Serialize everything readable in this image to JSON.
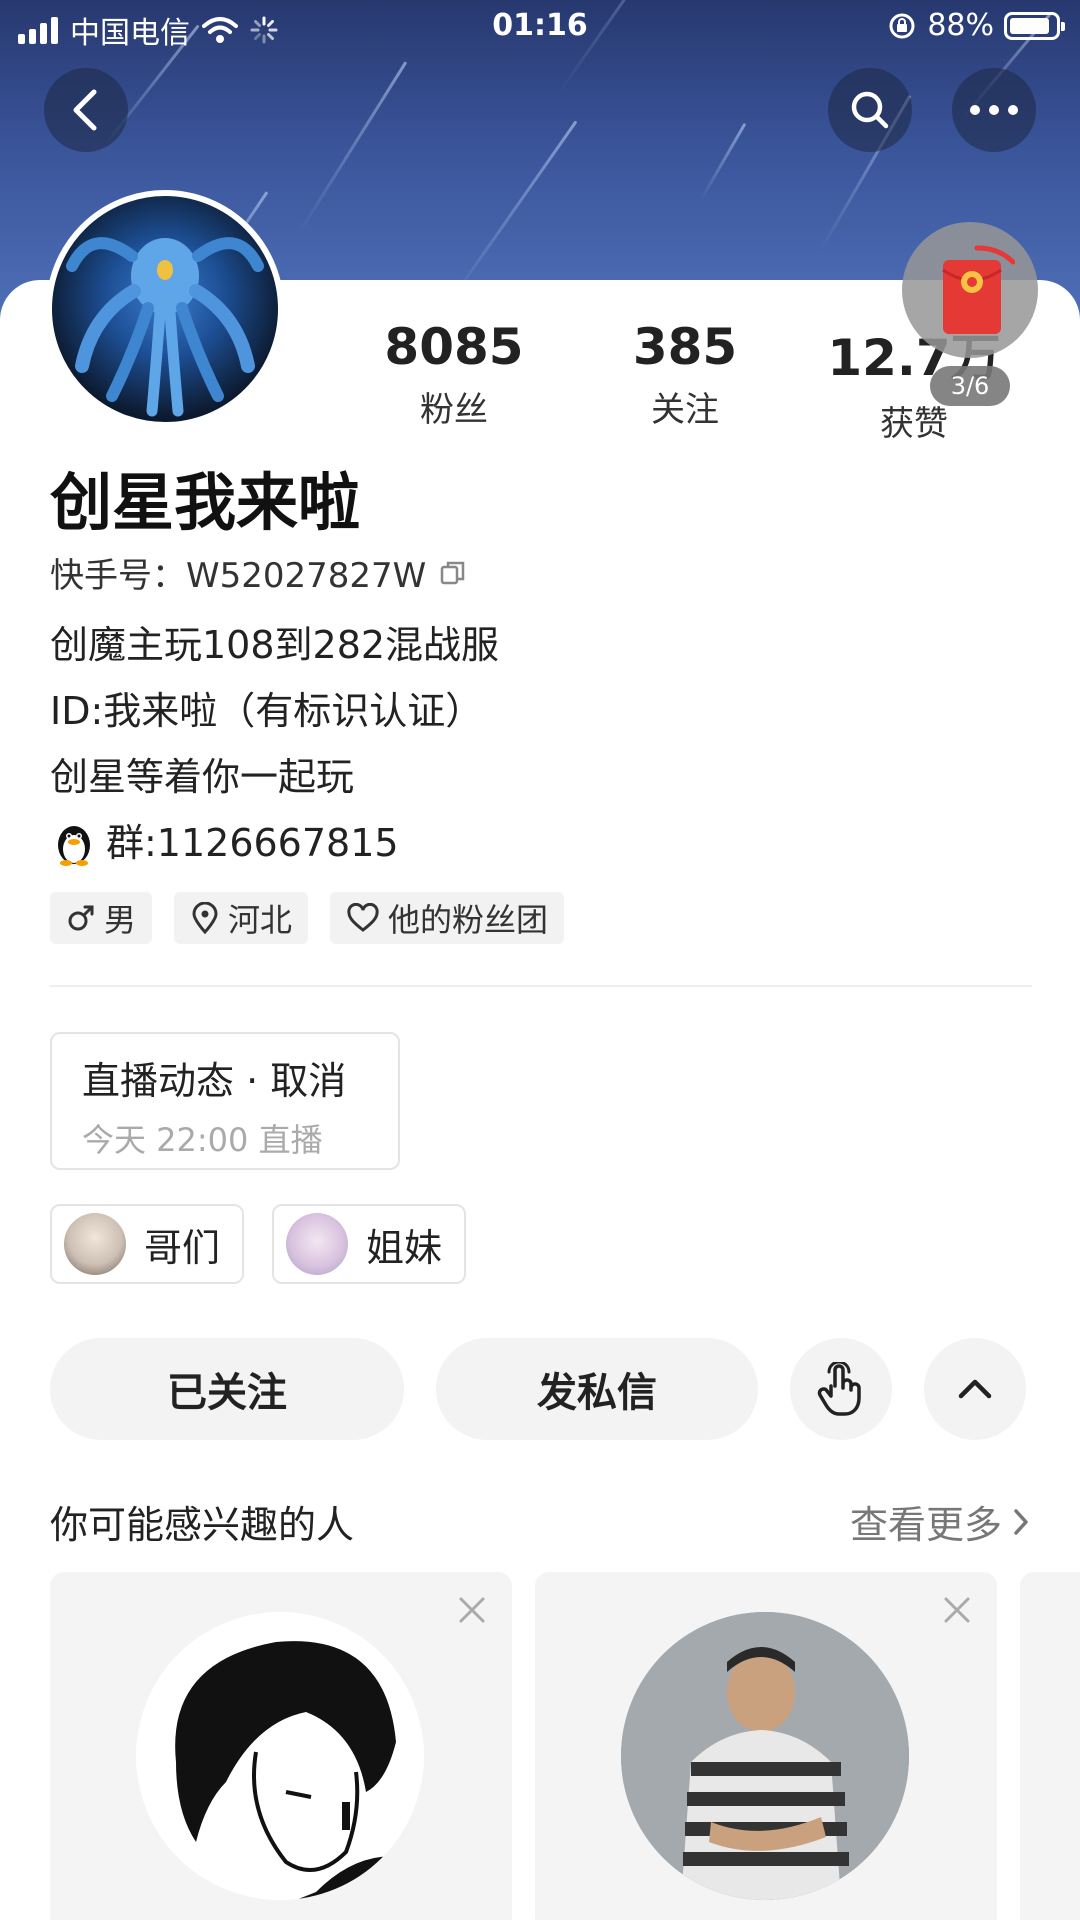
{
  "status_bar": {
    "carrier": "中国电信",
    "time": "01:16",
    "battery": "88%",
    "battery_level": 0.88
  },
  "profile": {
    "name": "创星我来啦",
    "ks_id_label": "快手号：",
    "ks_id": "W52027827W",
    "stats": [
      {
        "value": "8085",
        "label": "粉丝"
      },
      {
        "value": "385",
        "label": "关注"
      },
      {
        "value": "12.7万",
        "label": "获赞"
      }
    ],
    "bio": [
      "创魔主玩108到282混战服",
      "ID:我来啦（有标识认证）",
      "创星等着你一起玩",
      "群:1126667815"
    ],
    "tags": [
      {
        "icon": "male-icon",
        "label": "男"
      },
      {
        "icon": "location-icon",
        "label": "河北"
      },
      {
        "icon": "heart-icon",
        "label": "他的粉丝团"
      }
    ]
  },
  "red_packet": {
    "progress": "3/6"
  },
  "live": {
    "title": "直播动态 · 取消",
    "subtitle": "今天 22:00 直播"
  },
  "groups": [
    {
      "label": "哥们"
    },
    {
      "label": "姐妹"
    }
  ],
  "actions": {
    "follow": "已关注",
    "message": "发私信"
  },
  "recommend": {
    "title": "你可能感兴趣的人",
    "see_more": "查看更多"
  },
  "colors": {
    "banner": "#3a5499",
    "chip_bg": "#f2f2f2",
    "button_bg": "#f3f3f3",
    "red_packet": "#e53935"
  }
}
